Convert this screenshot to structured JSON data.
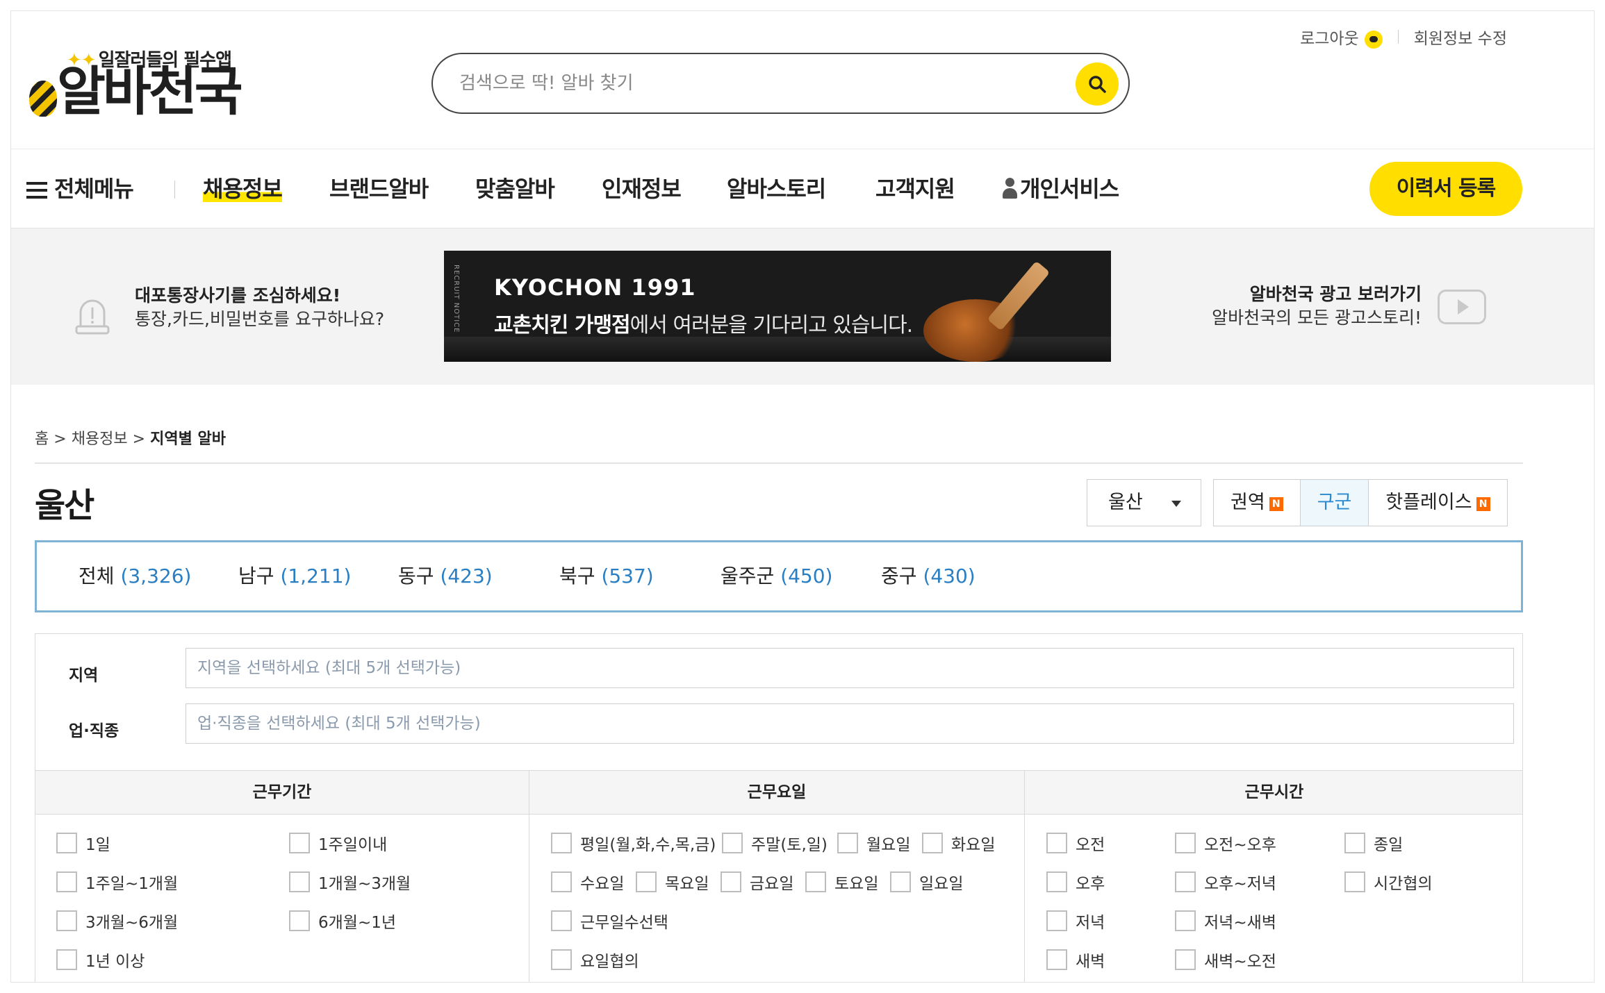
{
  "header": {
    "logo_tagline": "일잘러들의 필수앱",
    "logo_name": "알바천국",
    "search_placeholder": "검색으로 딱! 알바 찾기",
    "logout": "로그아웃",
    "member_edit": "회원정보 수정"
  },
  "nav": {
    "all_menu": "전체메뉴",
    "items": [
      "채용정보",
      "브랜드알바",
      "맞춤알바",
      "인재정보",
      "알바스토리",
      "고객지원",
      "개인서비스"
    ],
    "resume_button": "이력서 등록"
  },
  "banner": {
    "warn_title": "대포통장사기를 조심하세요!",
    "warn_sub": "통장,카드,비밀번호를 요구하나요?",
    "ad_side": "RECRUIT NOTICE",
    "ad_brand": "KYOCHON 1991",
    "ad_msg_bold": "교촌치킨 가맹점",
    "ad_msg_rest": "에서 여러분을 기다리고 있습니다.",
    "ad_link_title": "알바천국 광고 보러가기",
    "ad_link_sub": "알바천국의 모든 광고스토리!"
  },
  "breadcrumb": {
    "home": "홈",
    "sep": ">",
    "section": "채용정보",
    "current": "지역별 알바"
  },
  "region": {
    "title": "울산",
    "select_value": "울산",
    "tabs": [
      "권역",
      "구군",
      "핫플레이스"
    ],
    "districts": [
      {
        "name": "전체",
        "count": "(3,326)"
      },
      {
        "name": "남구",
        "count": "(1,211)"
      },
      {
        "name": "동구",
        "count": "(423)"
      },
      {
        "name": "북구",
        "count": "(537)"
      },
      {
        "name": "울주군",
        "count": "(450)"
      },
      {
        "name": "중구",
        "count": "(430)"
      }
    ]
  },
  "filters": {
    "region_label": "지역",
    "region_placeholder": "지역을 선택하세요 (최대 5개 선택가능)",
    "job_label": "업·직종",
    "job_placeholder": "업·직종을 선택하세요 (최대 5개 선택가능)",
    "period_title": "근무기간",
    "period_options": [
      "1일",
      "1주일이내",
      "1주일~1개월",
      "1개월~3개월",
      "3개월~6개월",
      "6개월~1년",
      "1년 이상"
    ],
    "days_title": "근무요일",
    "days_options": [
      "평일(월,화,수,목,금)",
      "주말(토,일)",
      "월요일",
      "화요일",
      "수요일",
      "목요일",
      "금요일",
      "토요일",
      "일요일",
      "근무일수선택",
      "요일협의"
    ],
    "time_title": "근무시간",
    "time_options": [
      "오전",
      "오전~오후",
      "종일",
      "오후",
      "오후~저녁",
      "시간협의",
      "저녁",
      "저녁~새벽",
      "새벽",
      "새벽~오전"
    ]
  },
  "colors": {
    "brand_yellow": "#ffde00",
    "link_blue": "#2a7fc4",
    "box_border_blue": "#7fb3d6",
    "badge_orange": "#ff6a00"
  }
}
